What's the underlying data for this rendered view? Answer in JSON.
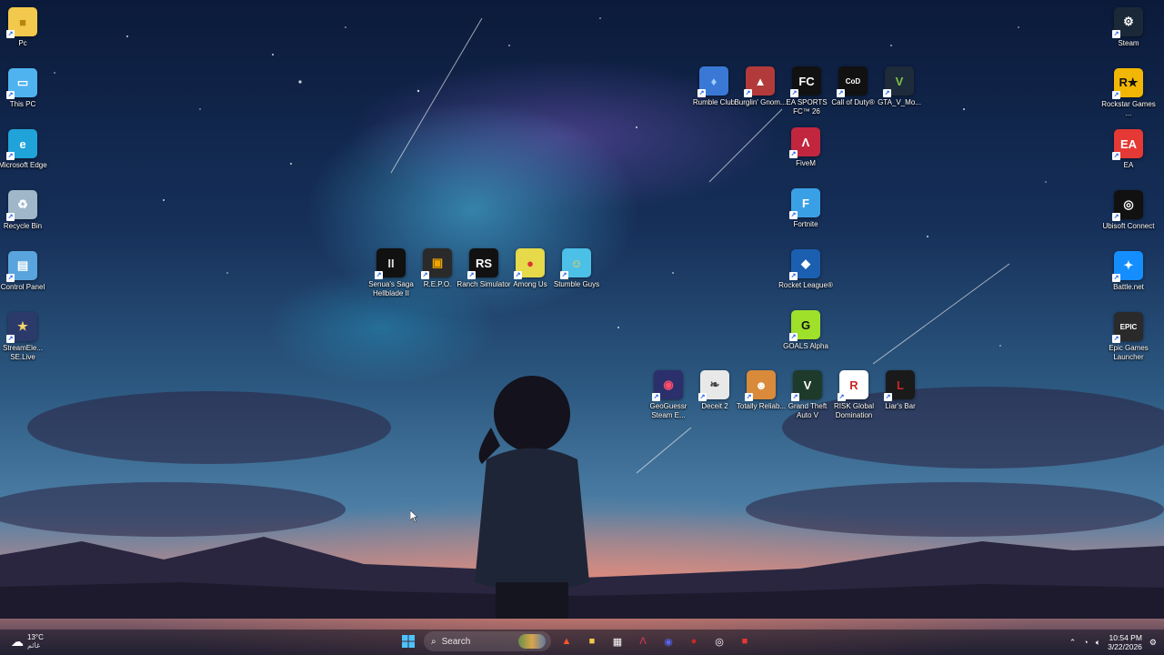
{
  "wallpaper": "anime-night-sky",
  "left_icons": [
    {
      "name": "pc-folder-icon",
      "label": "Pc",
      "glyph": "■",
      "bg": "#f2c94c",
      "color": "#b8860b"
    },
    {
      "name": "this-pc-icon",
      "label": "This PC",
      "glyph": "▭",
      "bg": "#4fb3f0",
      "color": "#ffffff"
    },
    {
      "name": "microsoft-edge-icon",
      "label": "Microsoft Edge",
      "glyph": "e",
      "bg": "#1fa3d9",
      "color": "#ffffff"
    },
    {
      "name": "recycle-bin-icon",
      "label": "Recycle Bin",
      "glyph": "♻",
      "bg": "#9fb7c8",
      "color": "#ffffff"
    },
    {
      "name": "control-panel-icon",
      "label": "Control Panel",
      "glyph": "▤",
      "bg": "#5aa4dd",
      "color": "#ffffff"
    },
    {
      "name": "streamelements-icon",
      "label": "StreamEle... SE.Live",
      "glyph": "★",
      "bg": "#2b3a6b",
      "color": "#f5d36b"
    }
  ],
  "middle_icons": [
    {
      "name": "senuas-saga-icon",
      "label": "Senua's Saga Hellblade II",
      "glyph": "II",
      "bg": "#111111",
      "color": "#dddddd"
    },
    {
      "name": "repo-icon",
      "label": "R.E.P.O.",
      "glyph": "▣",
      "bg": "#2a2a2a",
      "color": "#f0a500"
    },
    {
      "name": "ranch-simulator-icon",
      "label": "Ranch Simulator",
      "glyph": "RS",
      "bg": "#111111",
      "color": "#ffffff"
    },
    {
      "name": "among-us-icon",
      "label": "Among Us",
      "glyph": "●",
      "bg": "#e6d94a",
      "color": "#d33"
    },
    {
      "name": "stumble-guys-icon",
      "label": "Stumble Guys",
      "glyph": "☺",
      "bg": "#4cc0e6",
      "color": "#ffd34a"
    }
  ],
  "top_icons": [
    {
      "name": "rumble-club-icon",
      "label": "Rumble Club",
      "glyph": "♦",
      "bg": "#3a78d6",
      "color": "#9fd0ff"
    },
    {
      "name": "burglin-gnomes-icon",
      "label": "Burglin' Gnom...",
      "glyph": "▲",
      "bg": "#b33a3a",
      "color": "#ffffff"
    },
    {
      "name": "ea-sports-fc-icon",
      "label": "EA SPORTS FC™ 26",
      "glyph": "FC",
      "bg": "#111111",
      "color": "#ffffff"
    },
    {
      "name": "call-of-duty-icon",
      "label": "Call of Duty®",
      "glyph": "CoD",
      "bg": "#111111",
      "color": "#ffffff"
    },
    {
      "name": "gta-v-mods-icon",
      "label": "GTA_V_Mo...",
      "glyph": "V",
      "bg": "#1d2b3a",
      "color": "#7cc04a"
    }
  ],
  "column_icons": [
    {
      "name": "fivem-icon",
      "label": "FiveM",
      "glyph": "Λ",
      "bg": "#c2263f",
      "color": "#ffffff"
    },
    {
      "name": "fortnite-icon",
      "label": "Fortnite",
      "glyph": "F",
      "bg": "#3aa0e6",
      "color": "#ffffff"
    },
    {
      "name": "rocket-league-icon",
      "label": "Rocket League®",
      "glyph": "◆",
      "bg": "#1b5fb0",
      "color": "#ffffff"
    },
    {
      "name": "goals-alpha-icon",
      "label": "GOALS Alpha",
      "glyph": "G",
      "bg": "#9fe02a",
      "color": "#111111"
    }
  ],
  "bottom_icons": [
    {
      "name": "geoguessr-icon",
      "label": "GeoGuessr Steam E...",
      "glyph": "◉",
      "bg": "#2b2f6b",
      "color": "#ff4f6a"
    },
    {
      "name": "deceit-2-icon",
      "label": "Deceit 2",
      "glyph": "❧",
      "bg": "#e8e8e8",
      "color": "#444444"
    },
    {
      "name": "totally-reliable-icon",
      "label": "Totally Reliab...",
      "glyph": "☻",
      "bg": "#d98a3a",
      "color": "#ffffff"
    },
    {
      "name": "gta-v-icon",
      "label": "Grand Theft Auto V",
      "glyph": "V",
      "bg": "#1e3a2a",
      "color": "#ffffff"
    },
    {
      "name": "risk-global-domination-icon",
      "label": "RISK Global Domination",
      "glyph": "R",
      "bg": "#ffffff",
      "color": "#c62828"
    },
    {
      "name": "liars-bar-icon",
      "label": "Liar's Bar",
      "glyph": "L",
      "bg": "#1a1a1a",
      "color": "#c62828"
    }
  ],
  "right_icons": [
    {
      "name": "steam-icon",
      "label": "Steam",
      "glyph": "⚙",
      "bg": "#1b2838",
      "color": "#ffffff"
    },
    {
      "name": "rockstar-games-icon",
      "label": "Rockstar Games ...",
      "glyph": "R★",
      "bg": "#f2b705",
      "color": "#111111"
    },
    {
      "name": "ea-icon",
      "label": "EA",
      "glyph": "EA",
      "bg": "#e53935",
      "color": "#ffffff"
    },
    {
      "name": "ubisoft-connect-icon",
      "label": "Ubisoft Connect",
      "glyph": "◎",
      "bg": "#111111",
      "color": "#ffffff"
    },
    {
      "name": "battle-net-icon",
      "label": "Battle.net",
      "glyph": "✦",
      "bg": "#148eff",
      "color": "#ffffff"
    },
    {
      "name": "epic-games-launcher-icon",
      "label": "Epic Games Launcher",
      "glyph": "EPIC",
      "bg": "#2a2a2a",
      "color": "#ffffff"
    }
  ],
  "taskbar": {
    "weather_temp": "13°C",
    "weather_desc": "غائم",
    "search_placeholder": "Search",
    "apps": [
      {
        "name": "brave-icon",
        "glyph": "▲",
        "color": "#fb542b"
      },
      {
        "name": "file-explorer-icon",
        "glyph": "■",
        "color": "#f2c94c"
      },
      {
        "name": "microsoft-store-icon",
        "glyph": "▦",
        "color": "#ffffff"
      },
      {
        "name": "fivem-taskbar-icon",
        "glyph": "Λ",
        "color": "#e53950"
      },
      {
        "name": "discord-icon",
        "glyph": "◉",
        "color": "#5865f2"
      },
      {
        "name": "obs-icon",
        "glyph": "●",
        "color": "#c62828"
      },
      {
        "name": "capture-icon",
        "glyph": "◎",
        "color": "#ffffff"
      },
      {
        "name": "recording-icon",
        "glyph": "■",
        "color": "#e53935"
      }
    ],
    "time": "10:54 PM",
    "date": "3/22/2026"
  }
}
